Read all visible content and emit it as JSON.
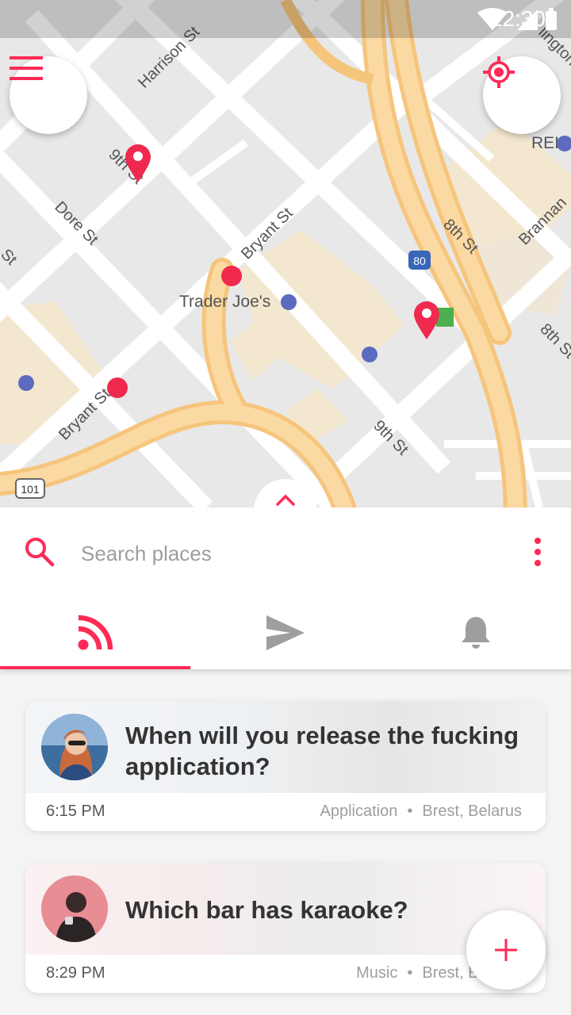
{
  "status_bar": {
    "time": "12:30"
  },
  "map": {
    "streets": {
      "harrison": "Harrison St",
      "ninth_top": "9th St",
      "dore": "Dore St",
      "bryant_mid": "Bryant St",
      "bryant_low": "Bryant St",
      "eighth_mid": "8th St",
      "eighth_right": "8th St",
      "ninth_low": "9th St",
      "brannan": "Brannan",
      "partial_top_right": "lington",
      "partial_left": "St"
    },
    "places": {
      "trader_joes": "Trader Joe's",
      "rei": "REI"
    },
    "highways": {
      "i80": "80",
      "us101": "101"
    }
  },
  "search": {
    "placeholder": "Search places"
  },
  "tabs": [
    {
      "name": "feed",
      "icon": "rss-icon",
      "active": true
    },
    {
      "name": "messages",
      "icon": "send-icon",
      "active": false
    },
    {
      "name": "notifications",
      "icon": "bell-icon",
      "active": false
    }
  ],
  "cards": [
    {
      "title": "When will you release the fucking application?",
      "time": "6:15 PM",
      "category": "Application",
      "location": "Brest, Belarus"
    },
    {
      "title": "Which bar has karaoke?",
      "time": "8:29 PM",
      "category": "Music",
      "location": "Brest, Belarus"
    }
  ],
  "colors": {
    "accent": "#ff2a56",
    "pin": "#f0294f",
    "road": "#ffffff",
    "highway": "#f8cc88"
  }
}
